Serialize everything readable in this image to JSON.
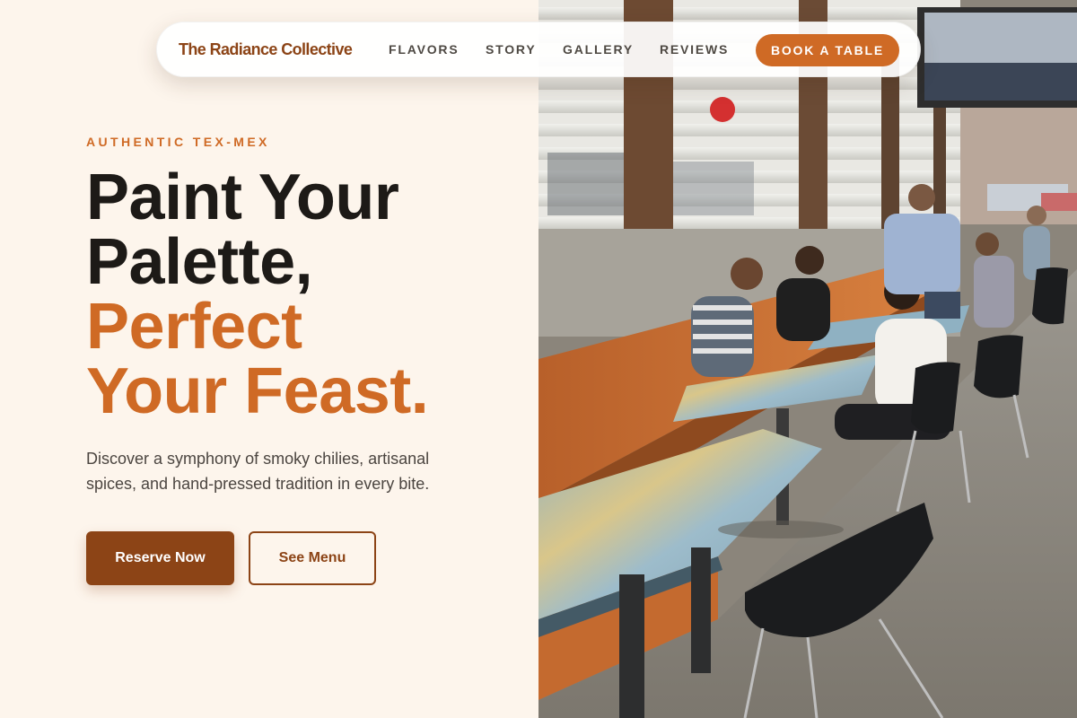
{
  "nav": {
    "brand": "The Radiance Collective",
    "links": [
      "FLAVORS",
      "STORY",
      "GALLERY",
      "REVIEWS"
    ],
    "cta": "BOOK A TABLE"
  },
  "hero": {
    "eyebrow": "AUTHENTIC TEX-MEX",
    "headline_lines": [
      "Paint Your",
      "Palette,"
    ],
    "headline_accent_lines": [
      "Perfect",
      "Your Feast."
    ],
    "description": "Discover a symphony of smoky chilies, artisanal spices, and hand-pressed tradition in every bite.",
    "primary_button": "Reserve Now",
    "secondary_button": "See Menu"
  },
  "colors": {
    "background": "#fdf5ec",
    "accent": "#cf6a25",
    "brand_dark": "#8c4416",
    "heading": "#1d1a17"
  }
}
